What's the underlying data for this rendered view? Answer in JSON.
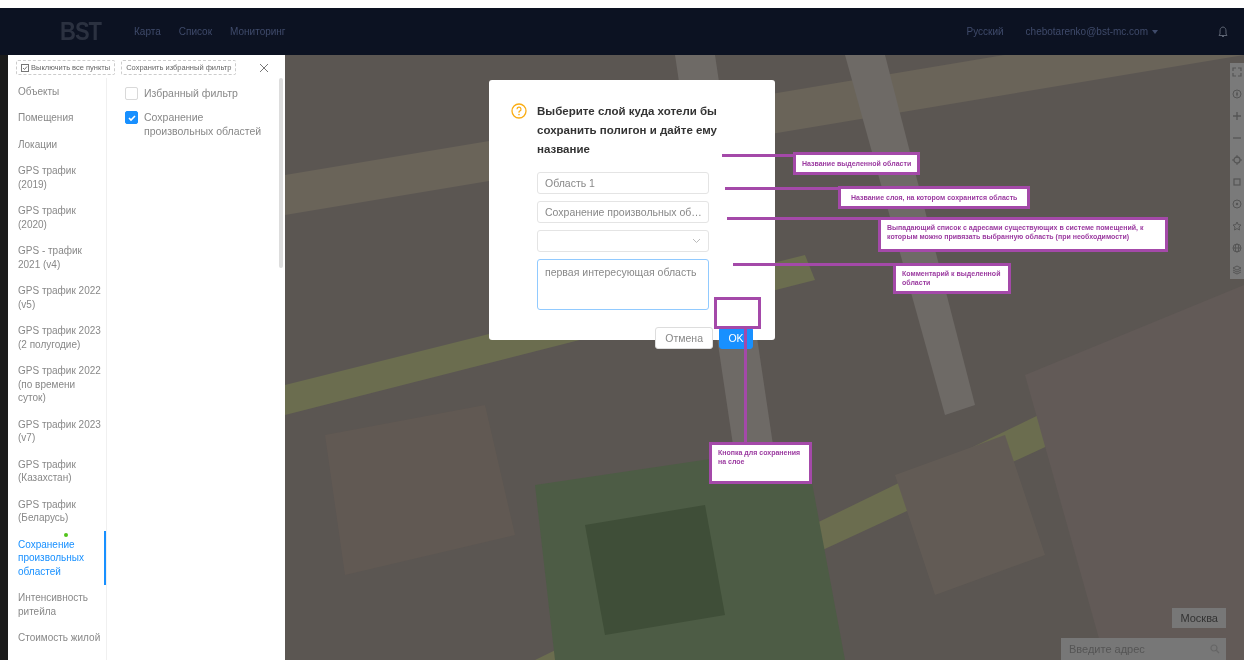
{
  "topbar": {
    "logo": "BST",
    "nav": [
      {
        "label": "Карта"
      },
      {
        "label": "Список"
      },
      {
        "label": "Мониторинг"
      }
    ],
    "language": "Русский",
    "user": "chebotarenko@bst-mc.com"
  },
  "sidebar": {
    "toggle_all_button": "Выключить все пункты",
    "save_filter_button": "Сохранить избранный фильтр",
    "categories": [
      {
        "label": "Объекты",
        "selected": false,
        "marked": false
      },
      {
        "label": "Помещения",
        "selected": false,
        "marked": false
      },
      {
        "label": "Локации",
        "selected": false,
        "marked": false
      },
      {
        "label": "GPS трафик (2019)",
        "selected": false,
        "marked": false
      },
      {
        "label": "GPS трафик (2020)",
        "selected": false,
        "marked": false
      },
      {
        "label": "GPS - трафик 2021 (v4)",
        "selected": false,
        "marked": false
      },
      {
        "label": "GPS трафик 2022 (v5)",
        "selected": false,
        "marked": false
      },
      {
        "label": "GPS трафик 2023 (2 полугодие)",
        "selected": false,
        "marked": false
      },
      {
        "label": "GPS трафик 2022 (по времени суток)",
        "selected": false,
        "marked": false
      },
      {
        "label": "GPS трафик 2023 (v7)",
        "selected": false,
        "marked": false
      },
      {
        "label": "GPS трафик (Казахстан)",
        "selected": false,
        "marked": false
      },
      {
        "label": "GPS трафик (Беларусь)",
        "selected": false,
        "marked": false
      },
      {
        "label": "Сохранение произвольных областей",
        "selected": true,
        "marked": true
      },
      {
        "label": "Интенсивность ритейла",
        "selected": false,
        "marked": false
      },
      {
        "label": "Стоимость жилой",
        "selected": false,
        "marked": false
      }
    ],
    "options": [
      {
        "label": "Избранный фильтр",
        "checked": false
      },
      {
        "label": "Сохранение произвольных областей",
        "checked": true
      }
    ]
  },
  "dialog": {
    "title": "Выберите слой куда хотели бы сохранить полигон и дайте ему название",
    "name_field": {
      "value": "Область 1"
    },
    "layer_select": {
      "value": "Сохранение произвольных об…"
    },
    "comment_field": {
      "value": "первая интересующая область"
    },
    "buttons": [
      {
        "label": "Отмена",
        "kind": "secondary"
      },
      {
        "label": "OK",
        "kind": "primary"
      }
    ]
  },
  "annotations": [
    {
      "text": "Название выделенной области"
    },
    {
      "text": "Название слоя, на котором сохранится область"
    },
    {
      "text": "Выпадающий список с адресами существующих в системе помещений, к которым можно привязать выбранную область (при необходимости)"
    },
    {
      "text": "Комментарий к выделенной области"
    },
    {
      "text": "Кнопка для сохранения на слое"
    }
  ],
  "map": {
    "city_button": "Москва",
    "address_search": {
      "placeholder": "Введите адрес"
    }
  }
}
